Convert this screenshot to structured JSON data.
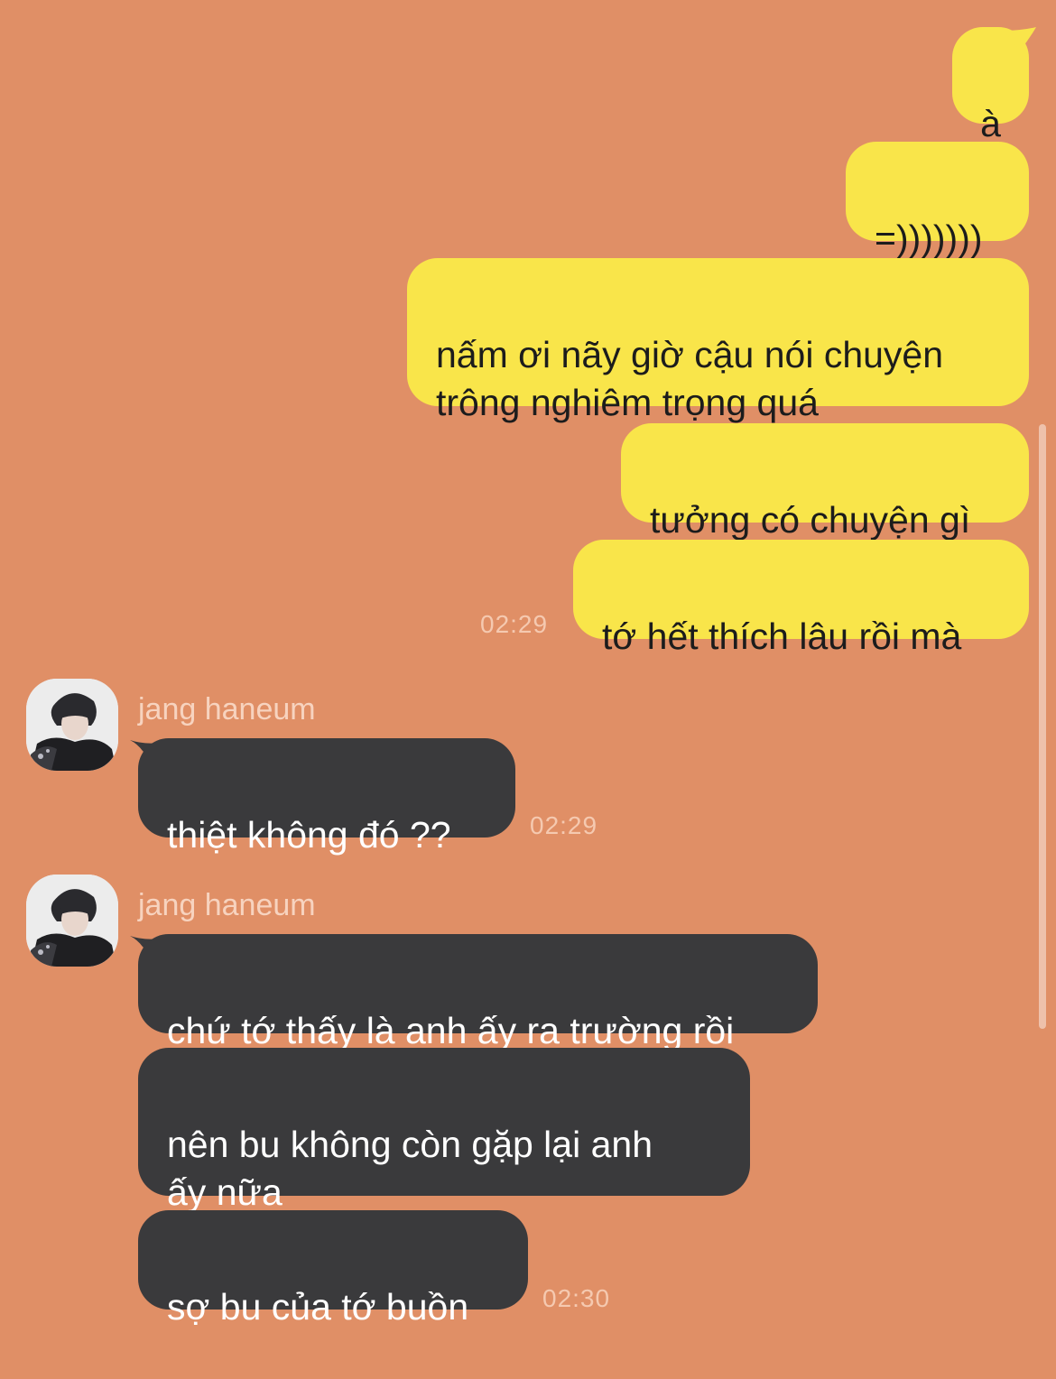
{
  "conversation": {
    "outgoing": [
      {
        "text": "à"
      },
      {
        "text": "=)))))))"
      },
      {
        "text": "nấm ơi nãy giờ cậu nói chuyện\ntrông nghiêm trọng quá"
      },
      {
        "text": "tưởng có chuyện gì"
      },
      {
        "text": "tớ hết thích lâu rồi mà"
      }
    ],
    "outgoing_time": "02:29",
    "group1": {
      "sender": "jang haneum",
      "messages": [
        {
          "text": "thiệt không đó ??"
        }
      ],
      "time": "02:29"
    },
    "group2": {
      "sender": "jang haneum",
      "messages": [
        {
          "text": "chứ tớ thấy là anh ấy ra trường rồi"
        },
        {
          "text": "nên bu không còn gặp lại anh\nấy nữa"
        },
        {
          "text": "sợ bu của tớ buồn"
        }
      ],
      "time": "02:30"
    }
  },
  "colors": {
    "background": "#e08f66",
    "outgoing_bubble": "#f9e54a",
    "incoming_bubble": "#3a3a3c",
    "timestamp": "#f5c9b0"
  }
}
